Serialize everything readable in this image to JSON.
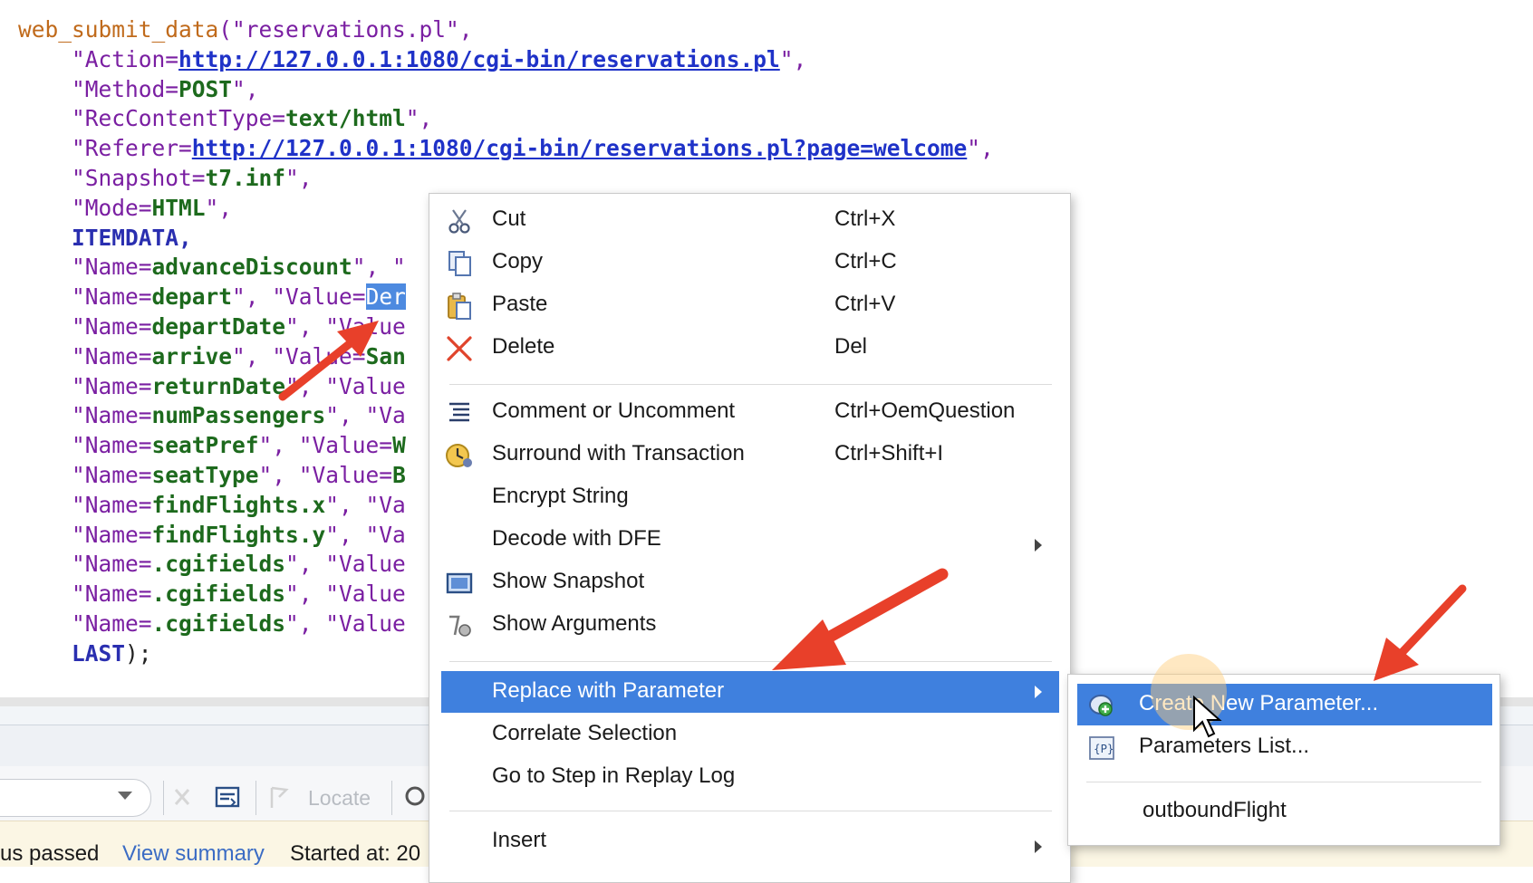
{
  "code": {
    "line1_fn": "web_submit_data",
    "line1_args": "(\"reservations.pl\",",
    "action_key": "\"Action=",
    "action_url": "http://127.0.0.1:1080/cgi-bin/reservations.pl",
    "action_end": "\",",
    "method_key": "\"Method=",
    "method_val": "POST",
    "method_end": "\",",
    "rct_key": "\"RecContentType=",
    "rct_val": "text/html",
    "rct_end": "\",",
    "ref_key": "\"Referer=",
    "ref_url": "http://127.0.0.1:1080/cgi-bin/reservations.pl?page=welcome",
    "ref_end": "\",",
    "snap_key": "\"Snapshot=",
    "snap_val": "t7.inf",
    "snap_end": "\",",
    "mode_key": "\"Mode=",
    "mode_val": "HTML",
    "mode_end": "\",",
    "itemdata": "ITEMDATA,",
    "rows": [
      {
        "key": "\"Name=",
        "name": "advanceDiscount",
        "rest": "\", \""
      },
      {
        "key": "\"Name=",
        "name": "depart",
        "rest": "\", \"Value=",
        "selected": "Der"
      },
      {
        "key": "\"Name=",
        "name": "departDate",
        "rest": "\", \"Value"
      },
      {
        "key": "\"Name=",
        "name": "arrive",
        "rest": "\", \"Value=",
        "tail": "San"
      },
      {
        "key": "\"Name=",
        "name": "returnDate",
        "rest": "\", \"Value"
      },
      {
        "key": "\"Name=",
        "name": "numPassengers",
        "rest": "\", \"Va"
      },
      {
        "key": "\"Name=",
        "name": "seatPref",
        "rest": "\", \"Value=",
        "tail": "W"
      },
      {
        "key": "\"Name=",
        "name": "seatType",
        "rest": "\", \"Value=",
        "tail": "B"
      },
      {
        "key": "\"Name=",
        "name": "findFlights.x",
        "rest": "\", \"Va"
      },
      {
        "key": "\"Name=",
        "name": "findFlights.y",
        "rest": "\", \"Va"
      },
      {
        "key": "\"Name=",
        "name": ".cgifields",
        "rest": "\", \"Value"
      },
      {
        "key": "\"Name=",
        "name": ".cgifields",
        "rest": "\", \"Value"
      },
      {
        "key": "\"Name=",
        "name": ".cgifields",
        "rest": "\", \"Value"
      }
    ],
    "last": "LAST",
    "last_end": ");"
  },
  "context_menu": {
    "items": [
      {
        "label": "Cut",
        "shortcut": "Ctrl+X",
        "icon": "scissors-icon"
      },
      {
        "label": "Copy",
        "shortcut": "Ctrl+C",
        "icon": "copy-icon"
      },
      {
        "label": "Paste",
        "shortcut": "Ctrl+V",
        "icon": "paste-icon"
      },
      {
        "label": "Delete",
        "shortcut": "Del",
        "icon": "delete-x-icon"
      },
      {
        "label": "Comment or Uncomment",
        "shortcut": "Ctrl+OemQuestion",
        "icon": "comment-lines-icon"
      },
      {
        "label": "Surround with Transaction",
        "shortcut": "Ctrl+Shift+I",
        "icon": "transaction-clock-icon"
      },
      {
        "label": "Encrypt String",
        "shortcut": ""
      },
      {
        "label": "Decode with DFE",
        "shortcut": ""
      },
      {
        "label": "Show Snapshot",
        "shortcut": "",
        "icon": "snapshot-window-icon"
      },
      {
        "label": "Show Arguments",
        "shortcut": "",
        "icon": "arguments-icon"
      },
      {
        "label": "Replace with Parameter",
        "shortcut": ""
      },
      {
        "label": "Correlate Selection",
        "shortcut": ""
      },
      {
        "label": "Go to Step in Replay Log",
        "shortcut": ""
      },
      {
        "label": "Insert",
        "shortcut": ""
      }
    ]
  },
  "submenu": {
    "items": [
      {
        "label": "Create New Parameter...",
        "icon": "new-parameter-icon"
      },
      {
        "label": "Parameters List...",
        "icon": "parameters-list-icon"
      },
      {
        "label": "outboundFlight"
      }
    ]
  },
  "toolbar": {
    "locate_label": "Locate"
  },
  "status_bar": {
    "status_text": "us passed",
    "view_summary": "View summary",
    "started_at": "Started at: 20"
  },
  "colors": {
    "highlight": "#3f80de",
    "annotation_arrow": "#e8402a",
    "link": "#3b6cc4"
  }
}
